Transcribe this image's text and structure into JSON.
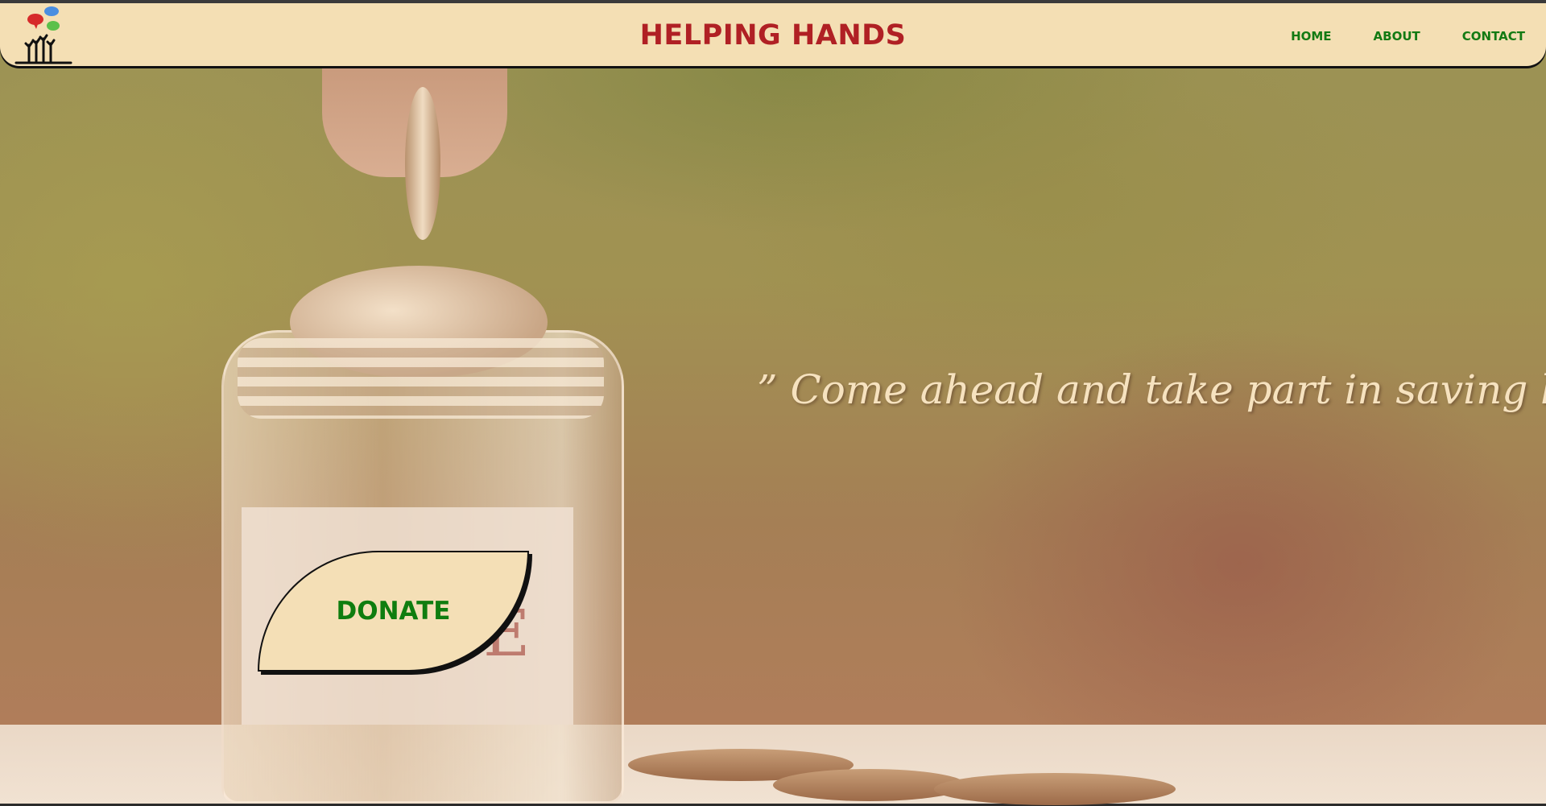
{
  "header": {
    "title": "HELPING HANDS",
    "nav": [
      {
        "label": "HOME"
      },
      {
        "label": "ABOUT"
      },
      {
        "label": "CONTACT"
      }
    ],
    "logo_icon": "helping-hands-logo-icon"
  },
  "hero": {
    "quote": "” Come ahead and take part in saving lives.”",
    "donate_label": "DONATE",
    "jar_label_text": "E"
  },
  "colors": {
    "header_bg": "#f4dfb4",
    "title": "#b02024",
    "nav": "#137a13",
    "quote": "#f6e2bf",
    "donate_text": "#0f7d0f"
  }
}
